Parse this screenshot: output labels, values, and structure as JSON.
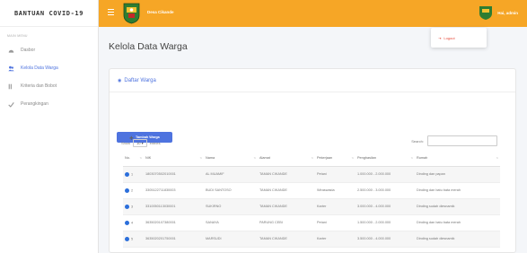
{
  "sidebar": {
    "brand": "BANTUAN COVID-19",
    "menu_heading": "MAIN MENU",
    "items": [
      {
        "label": "Dasbor",
        "icon": "dashboard-icon"
      },
      {
        "label": "Kelola Data Warga",
        "icon": "users-icon"
      },
      {
        "label": "Kriteria dan Bobot",
        "icon": "list-icon"
      },
      {
        "label": "Perangkingan",
        "icon": "check-icon"
      }
    ]
  },
  "topbar": {
    "title": "Desa Cikande",
    "user_name": "Hai, admin",
    "logout_label": "Logout"
  },
  "page": {
    "title": "Kelola Data Warga"
  },
  "card": {
    "header": "Daftar Warga",
    "add_button": "Tambah Warga",
    "show_label": "Show",
    "show_value": "10",
    "entries_label": "entries",
    "search_label": "Search:",
    "columns": [
      "No.",
      "NIK",
      "Nama",
      "Alamat",
      "Pekerjaan",
      "Penghasilan",
      "Rumah"
    ],
    "rows": [
      [
        "1",
        "1803070502010001",
        "AL MUAMIF",
        "TAMAN CIKANDE",
        "Petani",
        "1.000.000 - 2.000.000",
        "Dinding dan papan"
      ],
      [
        "2",
        "3305122711830003",
        "BUDI SANTOSO",
        "TAMAN CIKANDE",
        "Wiraswasta",
        "2.500.000 - 3.000.000",
        "Dinding dan batu bata merah"
      ],
      [
        "3",
        "3310050113030001",
        "SUKIRNO",
        "TAMAN CIKANDE",
        "Karter",
        "3.000.000 - 4.000.000",
        "Dinding sudah diesnamik"
      ],
      [
        "4",
        "3635020107380001",
        "SANAYA",
        "PARUNG CEBI",
        "Petani",
        "1.500.000 - 2.000.000",
        "Dinding dan batu bata merah"
      ],
      [
        "5",
        "3635020201750001",
        "MARSUDI",
        "TAMAN CIKANDE",
        "Karter",
        "3.500.000 - 4.000.000",
        "Dinding sudah diesnamik"
      ]
    ]
  },
  "colors": {
    "topbar": "#f6a626",
    "primary": "#4e73df",
    "logout": "#e74a3b"
  }
}
